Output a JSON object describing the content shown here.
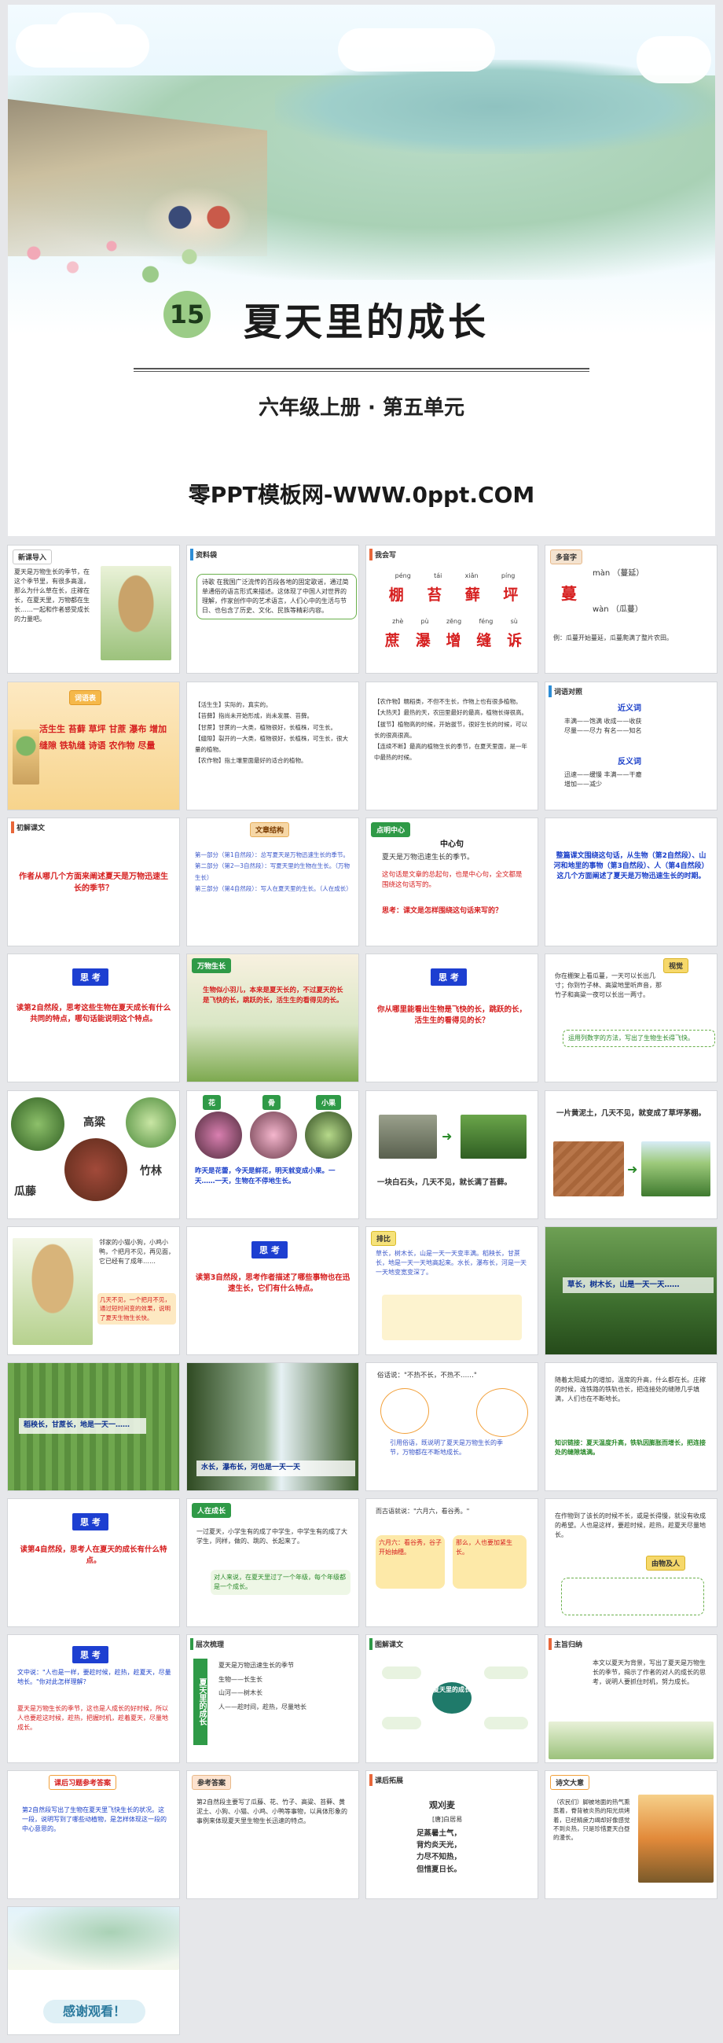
{
  "cover": {
    "lesson_number": "15",
    "title": "夏天里的成长",
    "subtitle": "六年级上册 · 第五单元",
    "site": "零PPT模板网-WWW.0ppt.COM"
  },
  "slides": {
    "s1": {
      "tag": "新课导入",
      "text": "夏天是万物生长的季节，在这个季节里，有很多高温，那么为什么草在长，庄稼在长，在夏天里，万物都在生长……一起和作者感受成长的力量吧。"
    },
    "s2": {
      "tag": "资料袋",
      "text": "诗歌  在我国广泛流传的百段各地的固定歌谣，通过简单通俗的语言形式来描述。这体现了中国人对世界的理解，作家创作中的艺术语言，人们心中的生活与节日、也包含了历史、文化、民族等精彩内容。"
    },
    "s3": {
      "tag": "我会写",
      "pinyin_top": [
        "péng",
        "tái",
        "xiǎn",
        "píng"
      ],
      "hanzi_top": [
        "棚",
        "苔",
        "藓",
        "坪"
      ],
      "pinyin_bottom": [
        "zhè",
        "pù",
        "zēng",
        "féng",
        "sù"
      ],
      "hanzi_bottom": [
        "蔗",
        "瀑",
        "增",
        "缝",
        "诉"
      ]
    },
    "s4": {
      "tag": "多音字",
      "char": "蔓",
      "reading1": "màn （蔓延）",
      "reading2": "wàn （瓜蔓）",
      "example": "例：瓜蔓开始蔓延，瓜蔓爬满了整片农田。"
    },
    "s5": {
      "tag": "词语表",
      "words": "活生生  苔藓  草坪  甘蔗  瀑布  增加  缝隙  铁轨缝  诗语  农作物  尽量"
    },
    "s6": {
      "text": "【活生生】实际的，真实的。\n【苔藓】指尚未开始形成，尚未发展、苔藓。\n【甘蔗】甘蔗的一大类，植物很好，长植株，可生长。\n【缝隙】裂开的一大类，植物很好，长植株，可生长，很大量的植物。\n【农作物】指土壤里面最好的适合的植物。"
    },
    "s7": {
      "text": "【农作物】糯稻类，不但不生长，作物上也有很多植物。\n【大热天】最热的天，农田里最好的最高，植物长得很高。\n【拔节】植物高的时候，开始拔节，很好生长的时候，可以长的很高很高。\n【连续不断】最高的植物生长的季节，在夏天里面，是一年中最热的时候。"
    },
    "s8": {
      "tag": "词语对照",
      "synonym_title": "近义词",
      "synonyms": "丰满——饱满  收成——收获\n尽量——尽力  有名——知名",
      "antonym_title": "反义词",
      "antonyms": "迅速——缓慢  丰满——干瘪\n增加——减少"
    },
    "s9": {
      "tag": "初解课文",
      "question": "作者从哪几个方面来阐述夏天是万物迅速生长的季节？"
    },
    "s10": {
      "title": "文章结构",
      "lines": "第一部分（第1自然段）：总写夏天是万物迅速生长的季节。\n第二部分（第2—3自然段）：写夏天里的生物在生长。（万物生长）\n第三部分（第4自然段）：写人在夏天里的生长。（人在成长）"
    },
    "s11": {
      "tag": "点明中心",
      "center": "中心句",
      "sentence": "夏天是万物迅速生长的季节。",
      "note": "这句话是文章的总起句，也是中心句，全文都是围绕这句话写的。",
      "question": "思考：课文是怎样围绕这句话来写的？"
    },
    "s12": {
      "text": "整篇课文围绕这句话，从生物（第2自然段）、山河和地里的事物（第3自然段）、人（第4自然段）这几个方面阐述了夏天是万物迅速生长的时期。"
    },
    "s13": {
      "think": "思  考",
      "question": "读第2自然段，思考这些生物在夏天成长有什么共同的特点，哪句话能说明这个特点。"
    },
    "s14": {
      "tag": "万物生长",
      "text": "生物似小羽儿，本来是夏天长的，不过夏天的长是飞快的长，跳跃的长，活生生的看得见的长。"
    },
    "s15": {
      "think": "思  考",
      "question": "你从哪里能看出生物是飞快的长，跳跃的长，活生生的看得见的长？"
    },
    "s16": {
      "tag": "视觉",
      "text": "你在棚架上看瓜蔓，一天可以长出几寸；你到竹子林、高粱地里听声音，那竹子和高粱一夜可以长出一两寸。",
      "note": "运用列数字的方法，写出了生物生长得飞快。"
    },
    "s17": {
      "labels": [
        "瓜藤",
        "高粱",
        "竹林"
      ]
    },
    "s18": {
      "labels": [
        "花",
        "骨",
        "小果"
      ],
      "text": "昨天是花蕾，今天是鲜花，明天就变成小果。一天……一天，生物在不停地生长。"
    },
    "s19": {
      "caption": "一块白石头，几天不见，就长满了苔藓。"
    },
    "s20": {
      "caption": "一片黄泥土，几天不见，就变成了草坪茅棚。"
    },
    "s21": {
      "text": "邻家的小猫小狗，小鸡小鸭，个把月不见，再见面，它已经有了成年……",
      "note": "几天不见，一个把月不见，通过短时间变的效果，说明了夏天生物生长快。"
    },
    "s22": {
      "think": "思  考",
      "question": "读第3自然段，思考作者描述了哪些事物也在迅速生长，它们有什么特点。"
    },
    "s23": {
      "tag": "排比",
      "text": "草长，树木长，山是一天一天变丰满。稻秧长，甘蔗长，地是一天一天地高起来。水长，瀑布长，河是一天一天地变宽变深了。"
    },
    "s24": {
      "caption": "草长，树木长，山是一天一天……"
    },
    "s25": {
      "caption": "稻秧长，甘蔗长，地是一天一……"
    },
    "s26": {
      "caption": "水长，瀑布长，河也是一天一天"
    },
    "s27": {
      "quote": "俗话说：\"不热不长，不热不……\"",
      "text": "引用俗语，既说明了夏天是万物生长的季节，万物都在不断地成长。"
    },
    "s28": {
      "text": "随着太阳威力的增加，温度的升高，什么都在长。庄稼的时候，连铁路的铁轨也长，把连接处的缝隙几乎填满，人们也在不断地长。",
      "knowledge": "知识链接：夏天温度升高，铁轨因膨胀而增长，把连接处的缝隙填满。"
    },
    "s29": {
      "think": "思  考",
      "question": "读第4自然段，思考人在夏天的成长有什么特点。"
    },
    "s30": {
      "tag": "人在成长",
      "text": "一过夏天，小学生有的成了中学生，中学生有的成了大学生，同样，做的、跳的、长起来了。",
      "note": "对人来说，在夏天里过了一个年级，每个年级都是一个成长。"
    },
    "s31": {
      "quote": "而古语就说：\"六月六，看谷秀。\"",
      "box1": "六月六：看谷秀，谷子开始抽穗。",
      "box2": "那么，人也要加紧生长。"
    },
    "s32": {
      "text": "在作物到了该长的时候不长，或是长得慢，就没有收成的希望。人也是这样，要趁时候，趁热，趁夏天尽量地长。",
      "tag": "由物及人"
    },
    "s33": {
      "think": "思  考",
      "question": "文中说：\"人也是一样，要趁时候，趁热，趁夏天，尽量地长。\"你对此怎样理解？",
      "answer": "夏天是万物生长的季节，这也是人成长的好时候，所以人也要趁这时候，趁热，把握时机，趁着夏天，尽量地成长。"
    },
    "s34": {
      "tag": "层次梳理",
      "root": "夏天里的成长",
      "lines": "夏天是万物迅速生长的季节\n生物——长生长\n山河——树木长\n人——趁时间，趁热，尽量地长"
    },
    "s35": {
      "tag": "图解课文",
      "center": "夏天里的成长"
    },
    "s36": {
      "tag": "主旨归纳",
      "text": "本文以夏天为背景，写出了夏天是万物生长的季节，揭示了作者的对人的成长的思考，说明人要抓住时机，努力成长。"
    },
    "s37": {
      "tag": "课后习题参考答案",
      "text": "第2自然段写出了生物在夏天里飞快生长的状况。这一段，说明写到了哪些动植物，是怎样体现这一段的中心意思的。"
    },
    "s38": {
      "tag": "参考答案",
      "text": "第2自然段主要写了瓜藤、花、竹子、高粱、苔藓、黄泥土、小狗、小猫、小鸡、小鸭等事物，以具体形象的事例来体现夏天里生物生长迅速的特点。"
    },
    "s39": {
      "tag": "课后拓展",
      "title": "观刈麦",
      "author": "[唐]白居易",
      "lines": "足蒸暑土气，\n背灼炎天光，\n力尽不知热，\n但惜夏日长。"
    },
    "s40": {
      "tag": "诗文大意",
      "text": "（农民们）脚被地面的热气熏蒸着，脊背被炎热的阳光烘烤着，已经精疲力竭却好像感觉不到炎热，只是珍惜夏天白昼的漫长。"
    },
    "s41": {
      "thanks": "感谢观看！"
    }
  },
  "colors": {
    "accent_red": "#d62020",
    "accent_blue": "#1a3fc9",
    "badge_green": "#9bcc87",
    "think_button": "#1d3fd1"
  }
}
